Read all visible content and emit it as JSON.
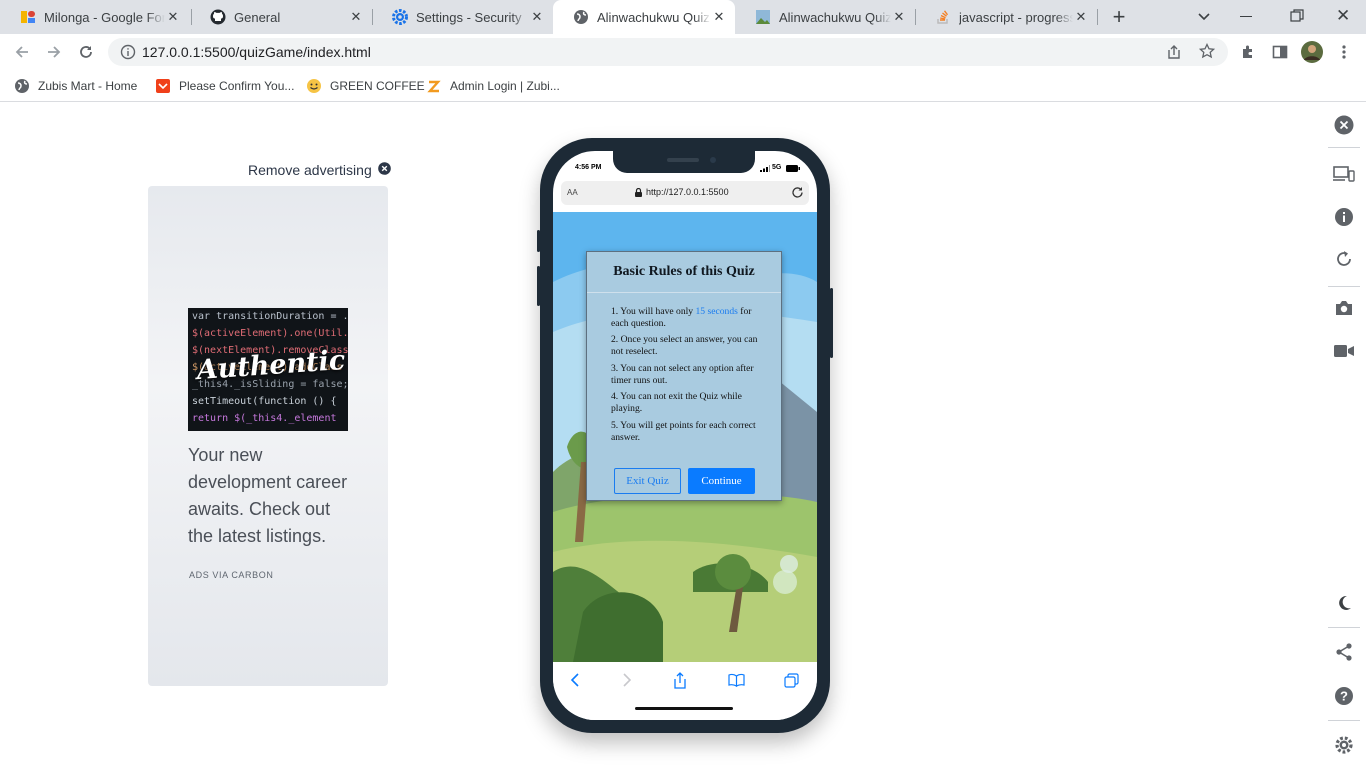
{
  "tabs": [
    {
      "title": "Milonga - Google Fonts",
      "icon": "google-fonts-icon",
      "active": false
    },
    {
      "title": "General",
      "icon": "github-icon",
      "active": false
    },
    {
      "title": "Settings - Security",
      "icon": "gear-icon",
      "active": false
    },
    {
      "title": "Alinwachukwu Quiz App",
      "icon": "globe-icon",
      "active": true
    },
    {
      "title": "Alinwachukwu Quiz App",
      "icon": "image-icon",
      "active": false
    },
    {
      "title": "javascript - progress bar",
      "icon": "stackoverflow-icon",
      "active": false
    }
  ],
  "toolbar": {
    "url": "127.0.0.1:5500/quizGame/index.html"
  },
  "bookmarks": [
    {
      "label": "Zubis Mart - Home",
      "icon": "globe-icon"
    },
    {
      "label": "Please Confirm You...",
      "icon": "mail-icon"
    },
    {
      "label": "GREEN COFFEE",
      "icon": "smiley-icon"
    },
    {
      "label": "Admin Login | Zubi...",
      "icon": "zap-icon"
    }
  ],
  "ad": {
    "remove_label": "Remove advertising",
    "image_text": "Authentic",
    "code_lines": [
      "var transitionDuration = ...",
      "$(activeElement).one(Util.TR",
      "$(nextElement).removeClass(",
      "$(activeElement).addClass",
      "_this4._isSliding = false;",
      "setTimeout(function () {",
      "return $(_this4._element"
    ],
    "text": "Your new development career awaits. Check out the latest listings.",
    "via": "ADS VIA CARBON"
  },
  "phone": {
    "time": "4:56 PM",
    "network": "5G",
    "aa": "AA",
    "url": "http://127.0.0.1:5500"
  },
  "quiz": {
    "title": "Basic Rules of this Quiz",
    "rules": [
      {
        "before": "1. You will have only ",
        "highlight": "15 seconds",
        "after": " for each question."
      },
      {
        "before": "2. Once you select an answer, you can not reselect.",
        "highlight": "",
        "after": ""
      },
      {
        "before": "3. You can not select any option after timer runs out.",
        "highlight": "",
        "after": ""
      },
      {
        "before": "4. You can not exit the Quiz while playing.",
        "highlight": "",
        "after": ""
      },
      {
        "before": "5. You will get points for each correct answer.",
        "highlight": "",
        "after": ""
      }
    ],
    "exit_label": "Exit Quiz",
    "continue_label": "Continue"
  },
  "colors": {
    "accent": "#1a7cf0",
    "sky": "#62b8f0",
    "phone_frame": "#1d2a36"
  }
}
